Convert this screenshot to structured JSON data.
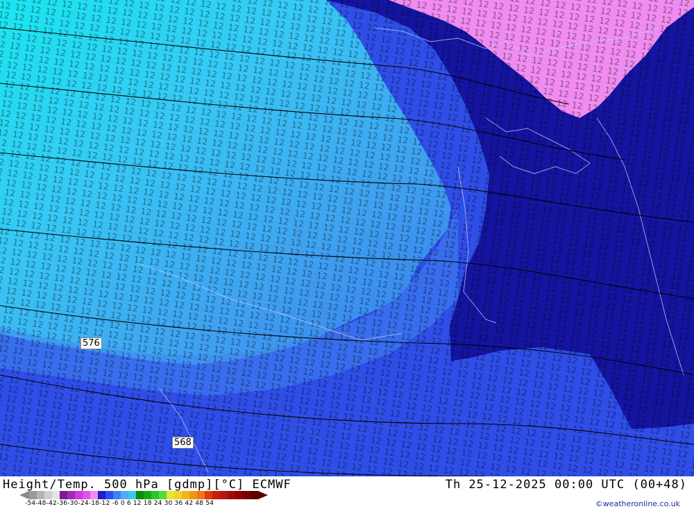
{
  "map": {
    "contour_labels": [
      "576",
      "568"
    ],
    "colors": {
      "pink": "#f08cf0",
      "navy": "#1414a0",
      "royal": "#2f4ee8",
      "mid_blue": "#3f86f0",
      "sky": "#37c8f5",
      "cyan": "#19e6f0"
    }
  },
  "footer": {
    "title": "Height/Temp. 500 hPa [gdmp][°C] ECMWF",
    "datetime": "Th 25-12-2025 00:00 UTC (00+48)",
    "credit": "©weatheronline.co.uk",
    "scale_ticks": "-54-48-42-36-30-24-18-12 -6  0  6  12  18  24  30  36  42  48  54",
    "colorbar": [
      "#9a9a9a",
      "#b4b4b4",
      "#cfcfcf",
      "#e6e6e6",
      "#7a1e8c",
      "#a02ab4",
      "#c83cdc",
      "#e650f0",
      "#f08cf0",
      "#1e1ec8",
      "#2850f0",
      "#3c82f5",
      "#50aaf5",
      "#3cc8f0",
      "#0a8c0a",
      "#14aa14",
      "#28c828",
      "#50dc3c",
      "#e6e632",
      "#f0d228",
      "#f0b41e",
      "#f09614",
      "#f07814",
      "#dc3c0a",
      "#c81e0a",
      "#b41414",
      "#a00a0a",
      "#8c0000",
      "#780000",
      "#640000"
    ]
  }
}
